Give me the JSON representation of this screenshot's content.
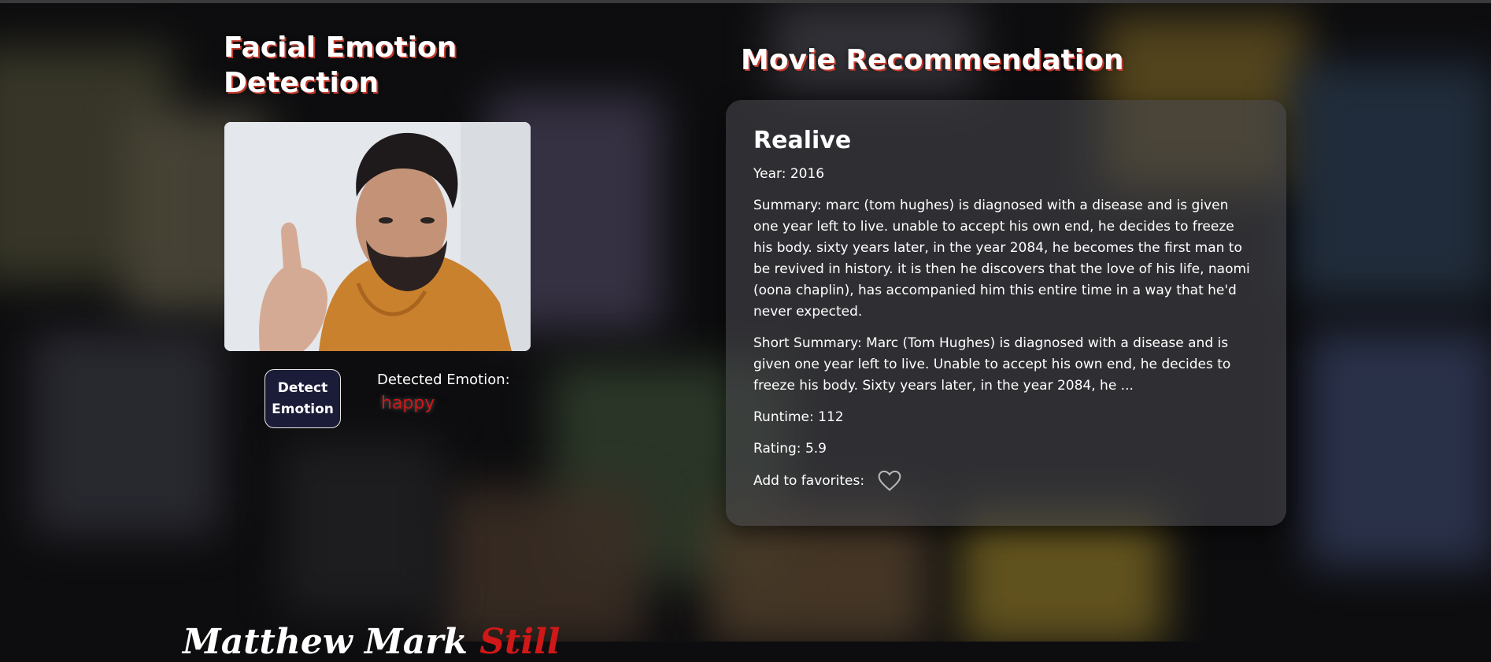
{
  "left": {
    "title": "Facial Emotion Detection",
    "detect_button": "Detect Emotion",
    "emotion_label": "Detected Emotion:",
    "emotion_value": "happy"
  },
  "right": {
    "title": "Movie Recommendation",
    "movie": {
      "title": "Realive",
      "year": "Year: 2016",
      "summary": "Summary: marc (tom hughes) is diagnosed with a disease and is given one year left to live. unable to accept his own end, he decides to freeze his body. sixty years later, in the year 2084, he becomes the first man to be revived in history. it is then he discovers that the love of his life, naomi (oona chaplin), has accompanied him this entire time in a way that he'd never expected.",
      "short_summary": "Short Summary: Marc (Tom Hughes) is diagnosed with a disease and is given one year left to live. Unable to accept his own end, he decides to freeze his body. Sixty years later, in the year 2084, he ...",
      "runtime": "Runtime: 112",
      "rating": "Rating: 5.9",
      "favorites_label": "Add to favorites:",
      "favorite_icon": "heart-outline-icon"
    }
  },
  "bottom": {
    "text_white": "Matthew Mark",
    "text_red": "Still"
  },
  "colors": {
    "accent_red": "#d01818",
    "button_bg": "#1b1c38",
    "card_bg": "rgba(70,70,74,0.62)"
  }
}
